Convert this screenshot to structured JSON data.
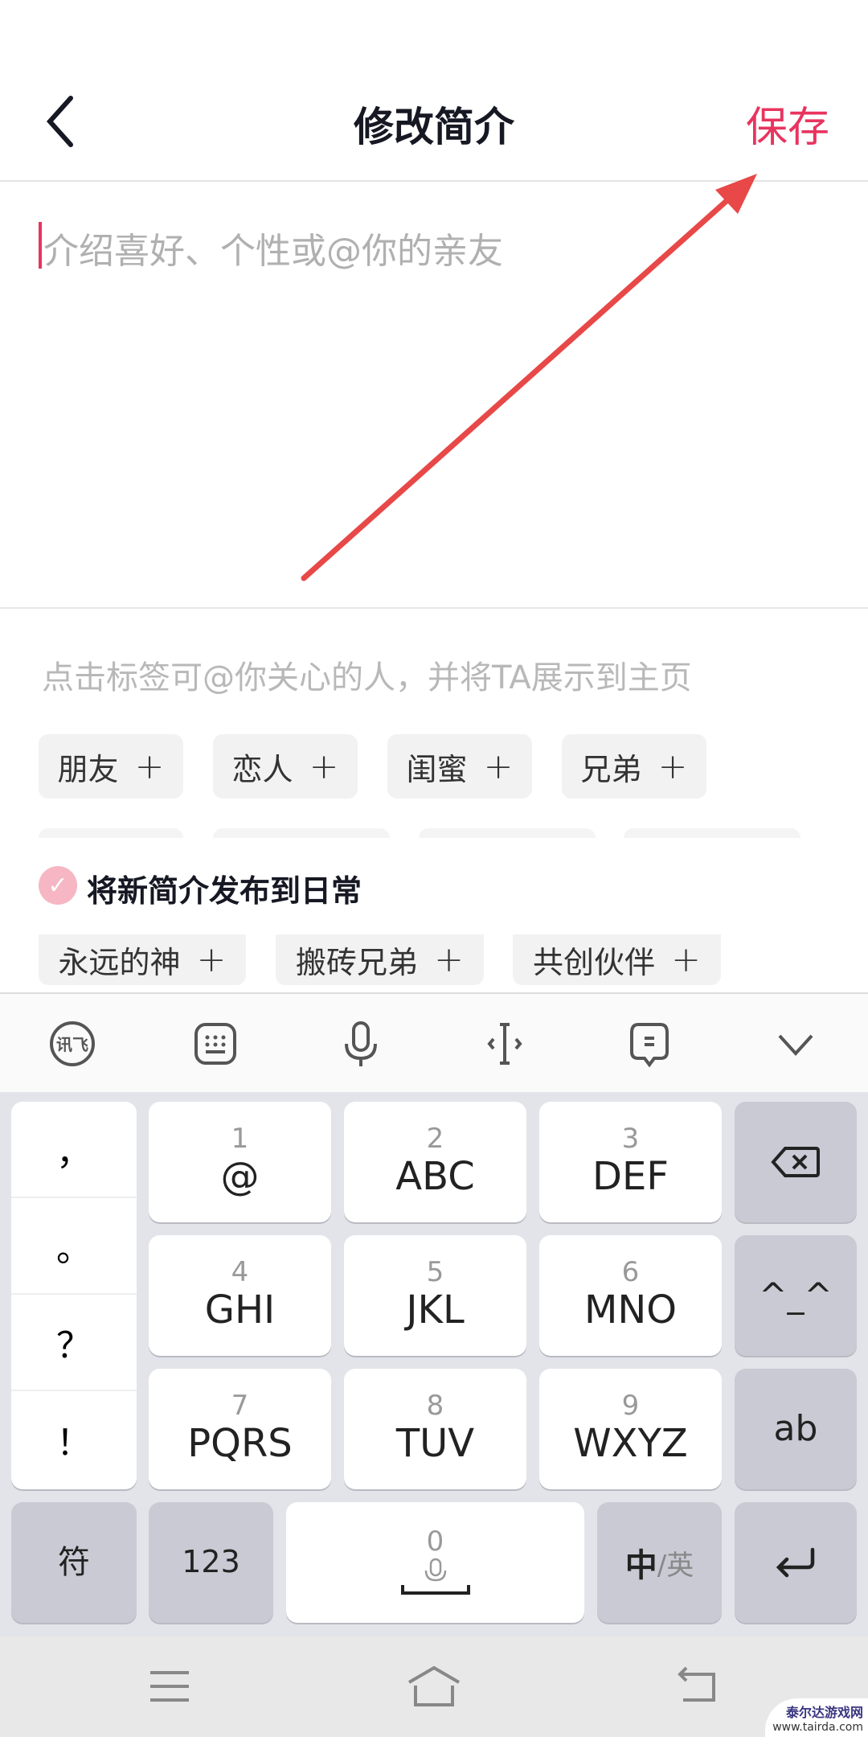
{
  "header": {
    "title": "修改简介",
    "save_label": "保存"
  },
  "editor": {
    "placeholder": "介绍喜好、个性或@你的亲友",
    "value": ""
  },
  "tags_section": {
    "hint": "点击标签可@你关心的人，并将TA展示到主页",
    "row1": [
      "朋友",
      "恋人",
      "闺蜜",
      "兄弟"
    ],
    "row3": [
      "永远的神",
      "搬砖兄弟",
      "共创伙伴"
    ],
    "plus": "+"
  },
  "publish": {
    "label": "将新简介发布到日常",
    "checked": true
  },
  "keyboard": {
    "toolbar": [
      "xunfei-icon",
      "keyboard-icon",
      "microphone-icon",
      "cursor-move-icon",
      "clipboard-icon",
      "collapse-icon"
    ],
    "punct": [
      "，",
      "。",
      "？",
      "！"
    ],
    "keys": [
      {
        "num": "1",
        "label": "@"
      },
      {
        "num": "2",
        "label": "ABC"
      },
      {
        "num": "3",
        "label": "DEF"
      },
      {
        "num": "4",
        "label": "GHI"
      },
      {
        "num": "5",
        "label": "JKL"
      },
      {
        "num": "6",
        "label": "MNO"
      },
      {
        "num": "7",
        "label": "PQRS"
      },
      {
        "num": "8",
        "label": "TUV"
      },
      {
        "num": "9",
        "label": "WXYZ"
      }
    ],
    "emoticon": "^_^",
    "ab": "ab",
    "symbols": "符",
    "numbers": "123",
    "space_num": "0",
    "lang_primary": "中",
    "lang_secondary": "/英"
  },
  "watermark": {
    "name": "泰尔达游戏网",
    "url": "www.tairda.com"
  },
  "colors": {
    "accent": "#e8345f",
    "annotation_arrow": "#e84848"
  }
}
